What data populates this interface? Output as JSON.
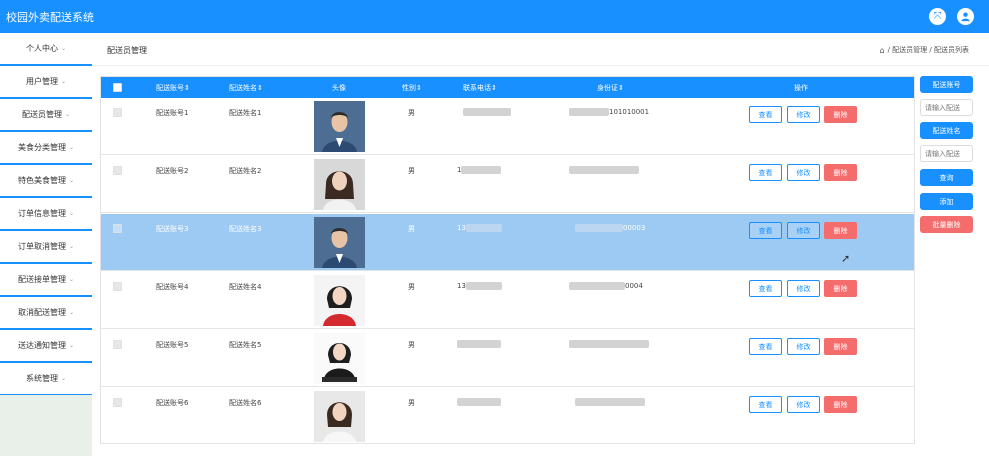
{
  "app": {
    "title": "校园外卖配送系统"
  },
  "topbar": {
    "fullscreen_icon": "expand-icon",
    "user_icon": "user-icon"
  },
  "sidebar": {
    "items": [
      {
        "label": "个人中心"
      },
      {
        "label": "用户管理"
      },
      {
        "label": "配送员管理"
      },
      {
        "label": "美食分类管理"
      },
      {
        "label": "特色美食管理"
      },
      {
        "label": "订单信息管理"
      },
      {
        "label": "订单取消管理"
      },
      {
        "label": "配送接单管理"
      },
      {
        "label": "取消配送管理"
      },
      {
        "label": "送达通知管理"
      },
      {
        "label": "系统管理"
      }
    ]
  },
  "header": {
    "page_title": "配送员管理",
    "breadcrumb": [
      "配送员管理",
      "配送员列表"
    ],
    "breadcrumb_sep": "/"
  },
  "table": {
    "columns": {
      "account": "配送账号",
      "name": "配送姓名",
      "avatar": "头像",
      "gender": "性别",
      "phone": "联系电话",
      "id_card": "身份证",
      "actions": "操作"
    },
    "rows": [
      {
        "account": "配送账号1",
        "name": "配送姓名1",
        "gender": "男",
        "phone": "",
        "id_card": "101010001",
        "selected": false
      },
      {
        "account": "配送账号2",
        "name": "配送姓名2",
        "gender": "男",
        "phone": "1",
        "id_card": "",
        "selected": false
      },
      {
        "account": "配送账号3",
        "name": "配送姓名3",
        "gender": "男",
        "phone": "13",
        "id_card": "00003",
        "selected": true
      },
      {
        "account": "配送账号4",
        "name": "配送姓名4",
        "gender": "男",
        "phone": "13",
        "id_card": "0004",
        "selected": false
      },
      {
        "account": "配送账号5",
        "name": "配送姓名5",
        "gender": "男",
        "phone": "",
        "id_card": "",
        "selected": false
      },
      {
        "account": "配送账号6",
        "name": "配送姓名6",
        "gender": "男",
        "phone": "",
        "id_card": "",
        "selected": false
      }
    ],
    "actions": {
      "view": "查看",
      "edit": "修改",
      "delete": "删除"
    }
  },
  "search_panel": {
    "account_label": "配送账号",
    "account_placeholder": "请输入配送",
    "name_label": "配送姓名",
    "name_placeholder": "请输入配送",
    "search_button": "查询",
    "add_button": "添加",
    "batch_delete_button": "批量删除"
  },
  "colors": {
    "primary": "#1890ff",
    "danger": "#f56c6c",
    "selected_row": "#9dcaf2"
  }
}
